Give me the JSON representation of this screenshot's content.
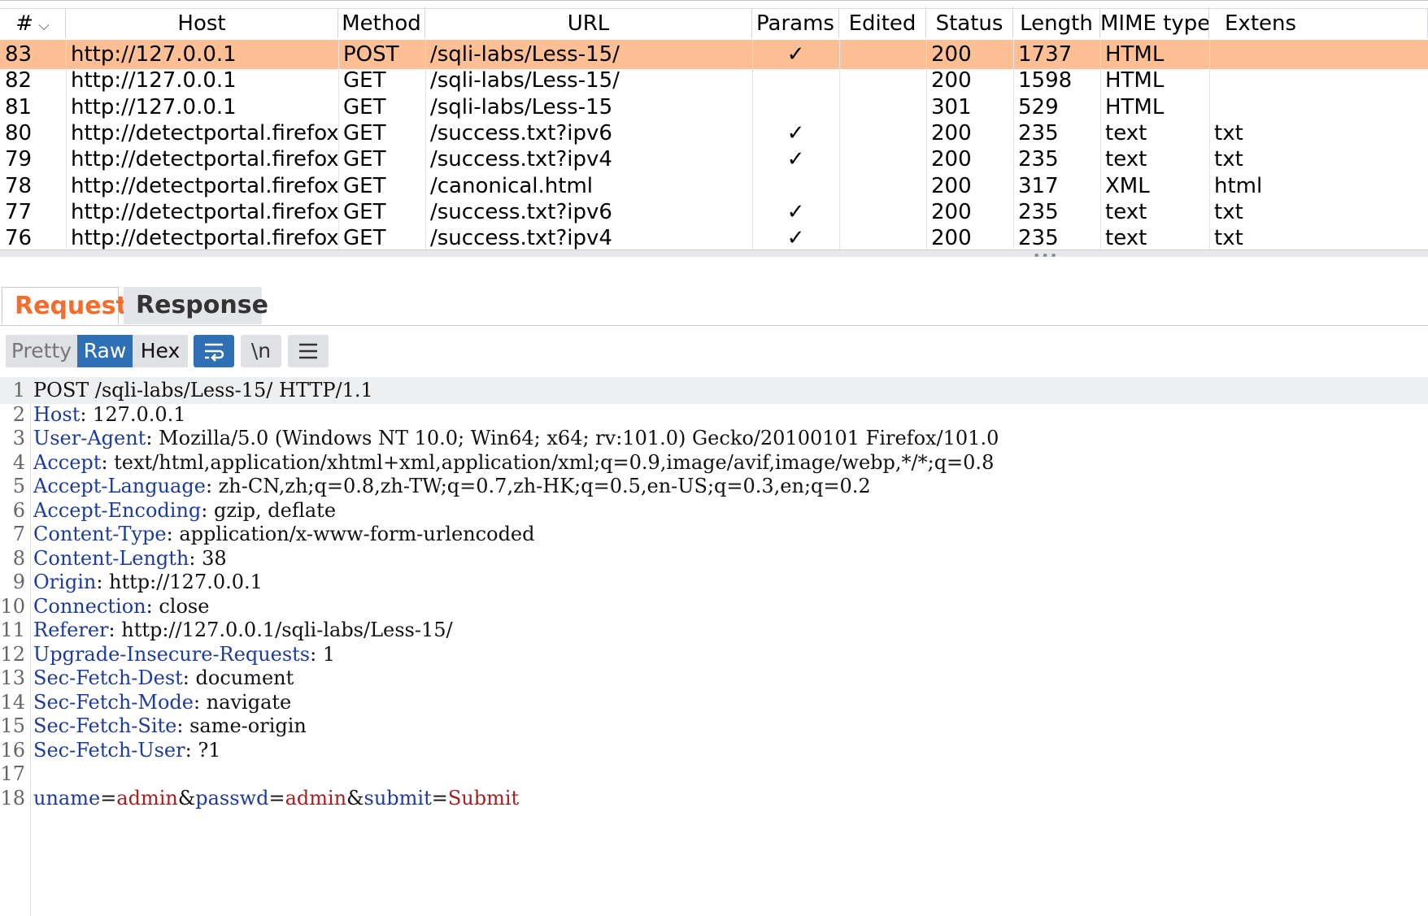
{
  "history": {
    "columns": [
      "#",
      "Host",
      "Method",
      "URL",
      "Params",
      "Edited",
      "Status",
      "Length",
      "MIME type",
      "Extens"
    ],
    "rows": [
      {
        "num": "83",
        "host": "http://127.0.0.1",
        "method": "POST",
        "url": "/sqli-labs/Less-15/",
        "params": "✓",
        "edited": "",
        "status": "200",
        "length": "1737",
        "mime": "HTML",
        "ext": "",
        "selected": true
      },
      {
        "num": "82",
        "host": "http://127.0.0.1",
        "method": "GET",
        "url": "/sqli-labs/Less-15/",
        "params": "",
        "edited": "",
        "status": "200",
        "length": "1598",
        "mime": "HTML",
        "ext": ""
      },
      {
        "num": "81",
        "host": "http://127.0.0.1",
        "method": "GET",
        "url": "/sqli-labs/Less-15",
        "params": "",
        "edited": "",
        "status": "301",
        "length": "529",
        "mime": "HTML",
        "ext": ""
      },
      {
        "num": "80",
        "host": "http://detectportal.firefox.com",
        "method": "GET",
        "url": "/success.txt?ipv6",
        "params": "✓",
        "edited": "",
        "status": "200",
        "length": "235",
        "mime": "text",
        "ext": "txt"
      },
      {
        "num": "79",
        "host": "http://detectportal.firefox.com",
        "method": "GET",
        "url": "/success.txt?ipv4",
        "params": "✓",
        "edited": "",
        "status": "200",
        "length": "235",
        "mime": "text",
        "ext": "txt"
      },
      {
        "num": "78",
        "host": "http://detectportal.firefox.com",
        "method": "GET",
        "url": "/canonical.html",
        "params": "",
        "edited": "",
        "status": "200",
        "length": "317",
        "mime": "XML",
        "ext": "html"
      },
      {
        "num": "77",
        "host": "http://detectportal.firefox.com",
        "method": "GET",
        "url": "/success.txt?ipv6",
        "params": "✓",
        "edited": "",
        "status": "200",
        "length": "235",
        "mime": "text",
        "ext": "txt"
      },
      {
        "num": "76",
        "host": "http://detectportal.firefox.com",
        "method": "GET",
        "url": "/success.txt?ipv4",
        "params": "✓",
        "edited": "",
        "status": "200",
        "length": "235",
        "mime": "text",
        "ext": "txt"
      }
    ],
    "selected_color": "#fdbf93"
  },
  "viewer": {
    "tabs": [
      "Request",
      "Response"
    ],
    "active_tab_color": "#f46d2c",
    "view_buttons": {
      "pretty": "Pretty",
      "raw": "Raw",
      "hex": "Hex",
      "newline": "\\n",
      "wrap_icon": "wrap-lines-icon",
      "menu_icon": "hamburger-menu-icon"
    },
    "accent_color": "#2f6fb4",
    "lines": [
      {
        "n": "1",
        "text": "POST /sqli-labs/Less-15/ HTTP/1.1"
      },
      {
        "n": "2",
        "key": "Host",
        "value": ": 127.0.0.1"
      },
      {
        "n": "3",
        "key": "User-Agent",
        "value": ": Mozilla/5.0 (Windows NT 10.0; Win64; x64; rv:101.0) Gecko/20100101 Firefox/101.0"
      },
      {
        "n": "4",
        "key": "Accept",
        "value": ": text/html,application/xhtml+xml,application/xml;q=0.9,image/avif,image/webp,*/*;q=0.8"
      },
      {
        "n": "5",
        "key": "Accept-Language",
        "value": ": zh-CN,zh;q=0.8,zh-TW;q=0.7,zh-HK;q=0.5,en-US;q=0.3,en;q=0.2"
      },
      {
        "n": "6",
        "key": "Accept-Encoding",
        "value": ": gzip, deflate"
      },
      {
        "n": "7",
        "key": "Content-Type",
        "value": ": application/x-www-form-urlencoded"
      },
      {
        "n": "8",
        "key": "Content-Length",
        "value": ": 38"
      },
      {
        "n": "9",
        "key": "Origin",
        "value": ": http://127.0.0.1"
      },
      {
        "n": "10",
        "key": "Connection",
        "value": ": close"
      },
      {
        "n": "11",
        "key": "Referer",
        "value": ": http://127.0.0.1/sqli-labs/Less-15/"
      },
      {
        "n": "12",
        "key": "Upgrade-Insecure-Requests",
        "value": ": 1"
      },
      {
        "n": "13",
        "key": "Sec-Fetch-Dest",
        "value": ": document"
      },
      {
        "n": "14",
        "key": "Sec-Fetch-Mode",
        "value": ": navigate"
      },
      {
        "n": "15",
        "key": "Sec-Fetch-Site",
        "value": ": same-origin"
      },
      {
        "n": "16",
        "key": "Sec-Fetch-User",
        "value": ": ?1"
      },
      {
        "n": "17",
        "text": ""
      },
      {
        "n": "18",
        "body": [
          {
            "t": "uname",
            "c": "pk"
          },
          {
            "t": "=",
            "c": ""
          },
          {
            "t": "admin",
            "c": "pv"
          },
          {
            "t": "&",
            "c": ""
          },
          {
            "t": "passwd",
            "c": "pk"
          },
          {
            "t": "=",
            "c": ""
          },
          {
            "t": "admin",
            "c": "pv"
          },
          {
            "t": "&",
            "c": ""
          },
          {
            "t": "submit",
            "c": "pk"
          },
          {
            "t": "=",
            "c": ""
          },
          {
            "t": "Submit",
            "c": "pv"
          }
        ]
      }
    ]
  }
}
